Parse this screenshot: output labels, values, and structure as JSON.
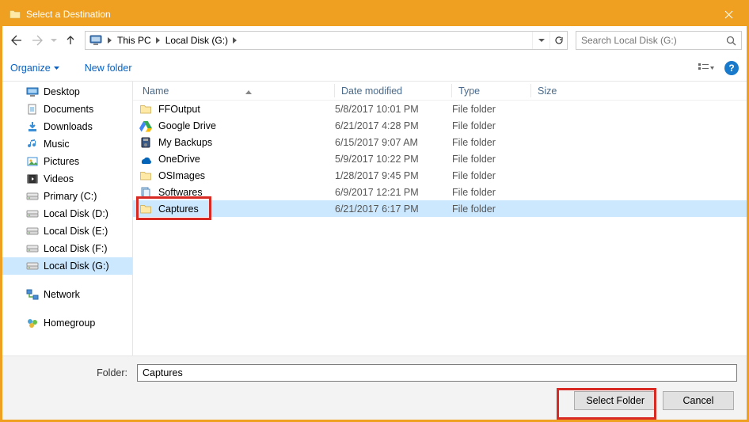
{
  "window": {
    "title": "Select a Destination"
  },
  "breadcrumb": {
    "pc": "This PC",
    "drive": "Local Disk (G:)"
  },
  "search": {
    "placeholder": "Search Local Disk (G:)"
  },
  "toolbar": {
    "organize": "Organize",
    "new_folder": "New folder"
  },
  "tree": {
    "items": [
      {
        "name": "desktop",
        "label": "Desktop"
      },
      {
        "name": "documents",
        "label": "Documents"
      },
      {
        "name": "downloads",
        "label": "Downloads"
      },
      {
        "name": "music",
        "label": "Music"
      },
      {
        "name": "pictures",
        "label": "Pictures"
      },
      {
        "name": "videos",
        "label": "Videos"
      },
      {
        "name": "disk-c",
        "label": "Primary (C:)"
      },
      {
        "name": "disk-d",
        "label": "Local Disk (D:)"
      },
      {
        "name": "disk-e",
        "label": "Local Disk (E:)"
      },
      {
        "name": "disk-f",
        "label": "Local Disk (F:)"
      },
      {
        "name": "disk-g",
        "label": "Local Disk (G:)"
      }
    ],
    "network": "Network",
    "homegroup": "Homegroup"
  },
  "columns": {
    "name": "Name",
    "date": "Date modified",
    "type": "Type",
    "size": "Size"
  },
  "files": [
    {
      "name": "FFOutput",
      "date": "5/8/2017 10:01 PM",
      "type": "File folder",
      "icon": "folder"
    },
    {
      "name": "Google Drive",
      "date": "6/21/2017 4:28 PM",
      "type": "File folder",
      "icon": "gdrive"
    },
    {
      "name": "My Backups",
      "date": "6/15/2017 9:07 AM",
      "type": "File folder",
      "icon": "backup"
    },
    {
      "name": "OneDrive",
      "date": "5/9/2017 10:22 PM",
      "type": "File folder",
      "icon": "onedrive"
    },
    {
      "name": "OSImages",
      "date": "1/28/2017 9:45 PM",
      "type": "File folder",
      "icon": "folder"
    },
    {
      "name": "Softwares",
      "date": "6/9/2017 12:21 PM",
      "type": "File folder",
      "icon": "soft"
    },
    {
      "name": "Captures",
      "date": "6/21/2017 6:17 PM",
      "type": "File folder",
      "icon": "folder"
    }
  ],
  "selected_index": 6,
  "footer": {
    "label": "Folder:",
    "value": "Captures",
    "select": "Select Folder",
    "cancel": "Cancel"
  }
}
